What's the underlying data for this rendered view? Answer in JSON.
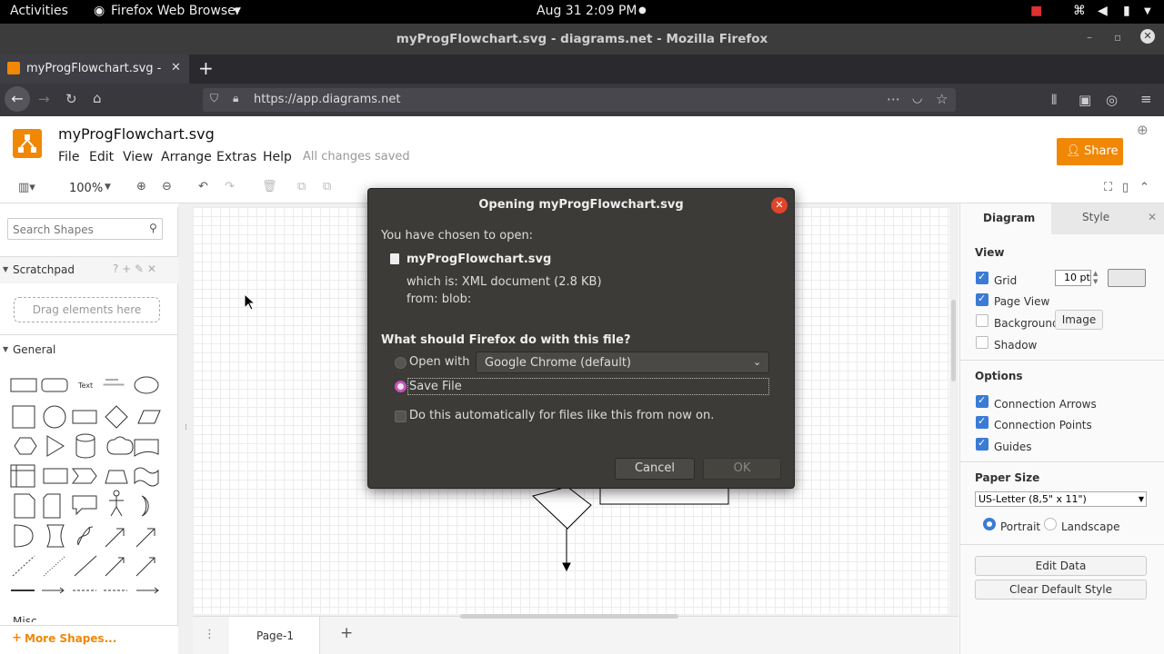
{
  "system_bar": {
    "activities": "Activities",
    "app_name": "Firefox Web Browser",
    "clock": "Aug 31  2:09 PM"
  },
  "window": {
    "title": "myProgFlowchart.svg - diagrams.net - Mozilla Firefox"
  },
  "browser": {
    "tab_label": "myProgFlowchart.svg - d",
    "url": "https://app.diagrams.net"
  },
  "drawio": {
    "file_name": "myProgFlowchart.svg",
    "menus": [
      "File",
      "Edit",
      "View",
      "Arrange",
      "Extras",
      "Help"
    ],
    "save_status": "All changes saved",
    "share_label": "Share",
    "zoom": "100%",
    "search_placeholder": "Search Shapes",
    "scratchpad_title": "Scratchpad",
    "scratchpad_drop": "Drag elements here",
    "general_title": "General",
    "misc_title": "Misc",
    "more_shapes": "More Shapes...",
    "page_tab": "Page-1",
    "shape_text_label": "Text"
  },
  "right_panel": {
    "tabs": [
      "Diagram",
      "Style"
    ],
    "view_title": "View",
    "grid_label": "Grid",
    "grid_size": "10 pt",
    "page_view_label": "Page View",
    "background_label": "Background",
    "image_button": "Image",
    "shadow_label": "Shadow",
    "options_title": "Options",
    "connection_arrows": "Connection Arrows",
    "connection_points": "Connection Points",
    "guides": "Guides",
    "paper_size_title": "Paper Size",
    "paper_size_value": "US-Letter (8,5\" x 11\")",
    "portrait": "Portrait",
    "landscape": "Landscape",
    "edit_data": "Edit Data",
    "clear_default_style": "Clear Default Style"
  },
  "dialog": {
    "title": "Opening myProgFlowchart.svg",
    "chosen_text": "You have chosen to open:",
    "file_name": "myProgFlowchart.svg",
    "which_is": "which is: XML document (2.8 KB)",
    "from": "from: blob:",
    "question": "What should Firefox do with this file?",
    "open_with_label": "Open with",
    "open_with_app": "Google Chrome (default)",
    "save_file_label": "Save File",
    "auto_label": "Do this automatically for files like this from now on.",
    "cancel": "Cancel",
    "ok": "OK"
  },
  "colors": {
    "accent_orange": "#f08705",
    "checkbox_blue": "#3a7bd5",
    "dialog_bg": "#3c3b37",
    "close_red": "#e0452a"
  }
}
